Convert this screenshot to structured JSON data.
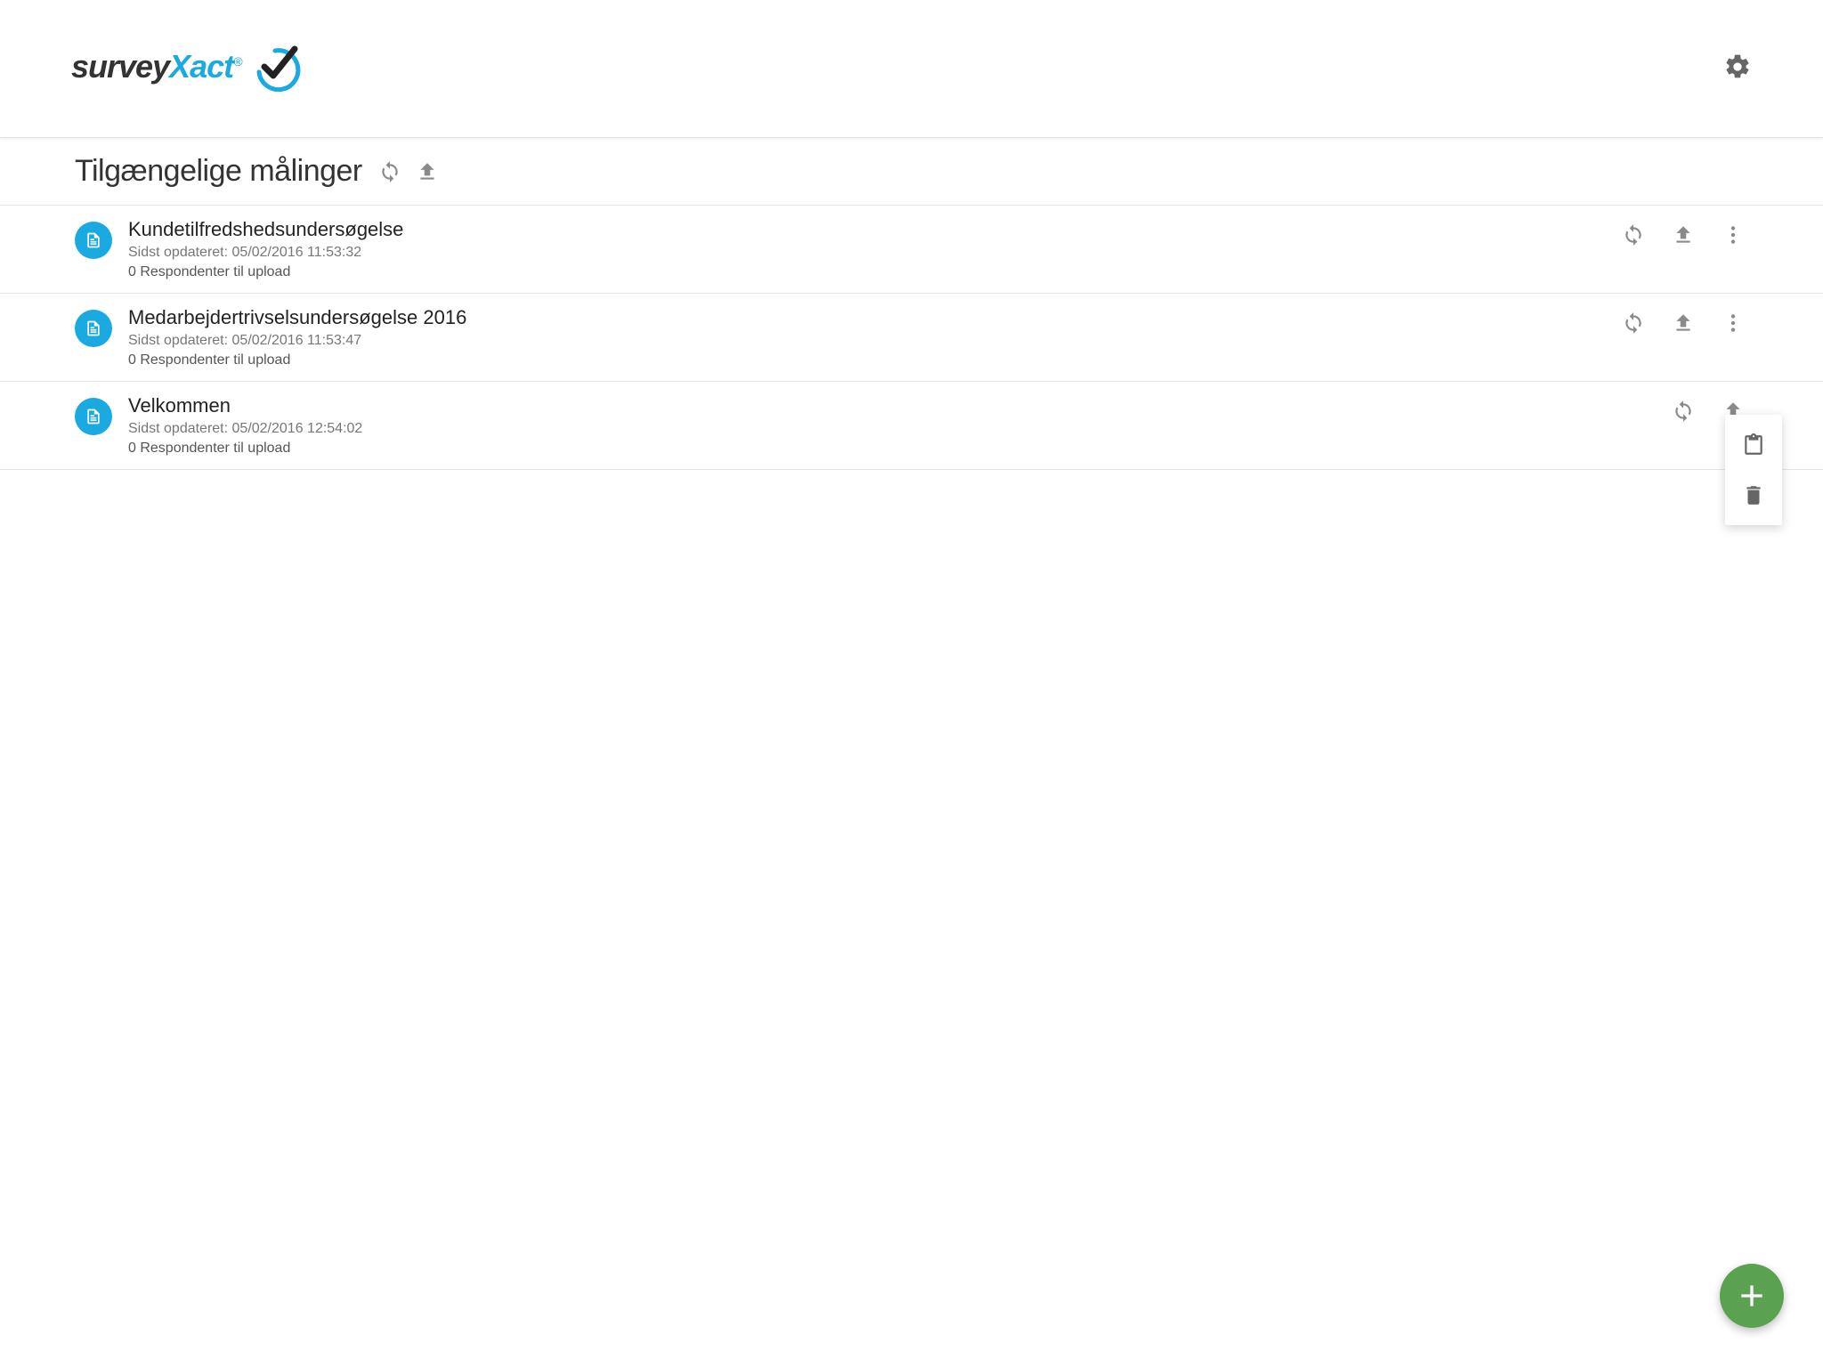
{
  "brand": {
    "part1": "survey",
    "part2": "Xact"
  },
  "header": {
    "title": "Tilgængelige målinger"
  },
  "labels": {
    "updated_prefix": "Sidst opdateret: ",
    "respondents_suffix": " Respondenter til upload"
  },
  "items": [
    {
      "title": "Kundetilfredshedsundersøgelse",
      "updated": "05/02/2016 11:53:32",
      "respondents": "0",
      "show_more": true
    },
    {
      "title": "Medarbejdertrivselsundersøgelse 2016",
      "updated": "05/02/2016 11:53:47",
      "respondents": "0",
      "show_more": true
    },
    {
      "title": "Velkommen",
      "updated": "05/02/2016 12:54:02",
      "respondents": "0",
      "show_more": false
    }
  ],
  "colors": {
    "accent": "#1ba9e1",
    "fab": "#5aa152"
  }
}
